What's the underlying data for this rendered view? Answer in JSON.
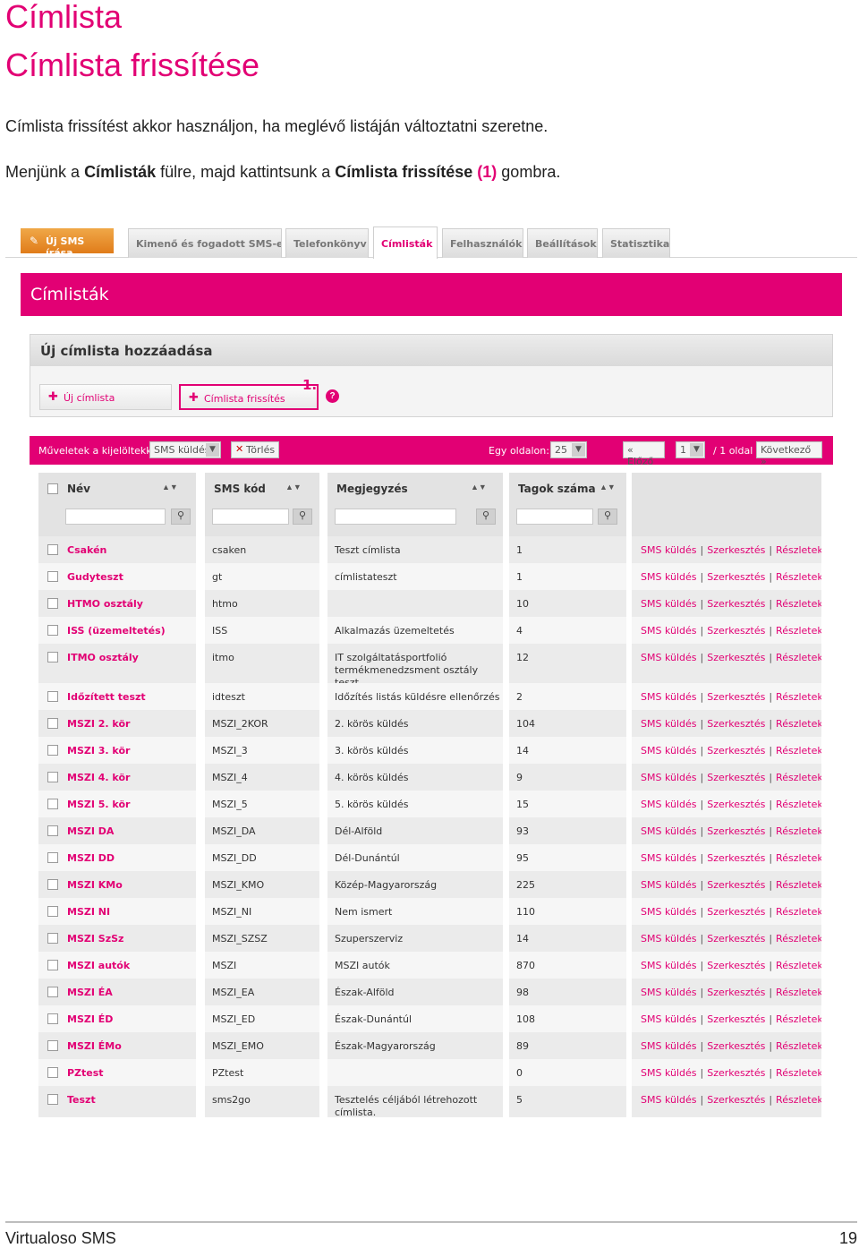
{
  "page": {
    "title": "Címlista",
    "subtitle": "Címlista frissítése",
    "para1": "Címlista frissítést akkor használjon, ha meglévő listáján változtatni szeretne.",
    "para2": {
      "part1": "Menjünk a ",
      "bold1": "Címlisták",
      "part2": " fülre, majd kattintsunk a ",
      "bold2": "Címlista frissítése",
      "num": "(1)",
      "part3": " gombra."
    }
  },
  "app": {
    "new_sms_tab": "Új SMS írása",
    "tabs": [
      {
        "label": "Kimenő és fogadott SMS-ek"
      },
      {
        "label": "Telefonkönyv"
      },
      {
        "label": "Címlisták"
      },
      {
        "label": "Felhasználók"
      },
      {
        "label": "Beállítások"
      },
      {
        "label": "Statisztika"
      }
    ],
    "section_title": "Címlisták",
    "add_box": {
      "title": "Új címlista hozzáadása",
      "new_button": "Új címlista",
      "refresh_button": "Címlista frissítés",
      "marker": "1.",
      "help": "?"
    },
    "toolbar": {
      "actions_label": "Műveletek a kijelöltekkel:",
      "action_select": "SMS küldés",
      "delete_button": "Törlés",
      "per_page_label": "Egy oldalon:",
      "per_page_value": "25",
      "prev_button": "« Előző",
      "page_value": "1",
      "page_suffix": "/ 1 oldal",
      "next_button": "Következő »"
    },
    "columns": [
      "Név",
      "SMS kód",
      "Megjegyzés",
      "Tagok száma"
    ],
    "row_actions": {
      "send": "SMS küldés",
      "edit": "Szerkesztés",
      "details": "Részletek"
    },
    "rows": [
      {
        "name": "Csakén",
        "code": "csaken",
        "note": "Teszt címlista",
        "count": "1"
      },
      {
        "name": "Gudyteszt",
        "code": "gt",
        "note": "címlistateszt",
        "count": "1"
      },
      {
        "name": "HTMO osztály",
        "code": "htmo",
        "note": "",
        "count": "10"
      },
      {
        "name": "ISS (üzemeltetés)",
        "code": "ISS",
        "note": "Alkalmazás üzemeltetés",
        "count": "4"
      },
      {
        "name": "ITMO osztály",
        "code": "itmo",
        "note": "IT szolgáltatásportfolió termékmenedzsment osztály teszt",
        "count": "12"
      },
      {
        "name": "Időzített teszt",
        "code": "idteszt",
        "note": "Időzítés listás küldésre ellenőrzés",
        "count": "2"
      },
      {
        "name": "MSZI 2. kör",
        "code": "MSZI_2KOR",
        "note": "2. körös küldés",
        "count": "104"
      },
      {
        "name": "MSZI 3. kör",
        "code": "MSZI_3",
        "note": "3. körös küldés",
        "count": "14"
      },
      {
        "name": "MSZI 4. kör",
        "code": "MSZI_4",
        "note": "4. körös küldés",
        "count": "9"
      },
      {
        "name": "MSZI 5. kör",
        "code": "MSZI_5",
        "note": "5. körös küldés",
        "count": "15"
      },
      {
        "name": "MSZI DA",
        "code": "MSZI_DA",
        "note": "Dél-Alföld",
        "count": "93"
      },
      {
        "name": "MSZI DD",
        "code": "MSZI_DD",
        "note": "Dél-Dunántúl",
        "count": "95"
      },
      {
        "name": "MSZI KMo",
        "code": "MSZI_KMO",
        "note": "Közép-Magyarország",
        "count": "225"
      },
      {
        "name": "MSZI NI",
        "code": "MSZI_NI",
        "note": "Nem ismert",
        "count": "110"
      },
      {
        "name": "MSZI SzSz",
        "code": "MSZI_SZSZ",
        "note": "Szuperszerviz",
        "count": "14"
      },
      {
        "name": "MSZI autók",
        "code": "MSZI",
        "note": "MSZI autók",
        "count": "870"
      },
      {
        "name": "MSZI ÉA",
        "code": "MSZI_EA",
        "note": "Észak-Alföld",
        "count": "98"
      },
      {
        "name": "MSZI ÉD",
        "code": "MSZI_ED",
        "note": "Észak-Dunántúl",
        "count": "108"
      },
      {
        "name": "MSZI ÉMo",
        "code": "MSZI_EMO",
        "note": "Észak-Magyarország",
        "count": "89"
      },
      {
        "name": "PZtest",
        "code": "PZtest",
        "note": "",
        "count": "0"
      },
      {
        "name": "Teszt",
        "code": "sms2go",
        "note": "Tesztelés céljából létrehozott címlista.",
        "count": "5"
      }
    ]
  },
  "footer": {
    "left": "Virtualoso SMS",
    "page_number": "19"
  }
}
